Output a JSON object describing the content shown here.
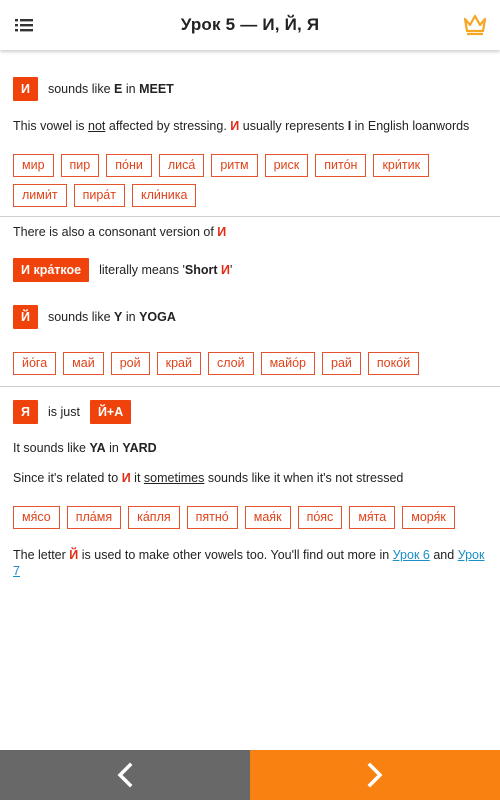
{
  "appbar": {
    "title": "Урок 5 — И, Й, Я",
    "menu_icon": "hamburger-menu-icon",
    "premium_icon": "crown-icon",
    "accent_color": "#f5a623"
  },
  "colors": {
    "badge": "#f0420b",
    "chip_border": "#e5542e",
    "highlight_letter": "#e32b15",
    "link": "#1b8fc7",
    "prev_button": "#686868",
    "next_button": "#f88112"
  },
  "section_i": {
    "badge": "И",
    "sounds": "sounds like",
    "sound_letter": "E",
    "in": "in",
    "example_word": "MEET",
    "para_part1": "This vowel is",
    "para_not": "not",
    "para_part2": "affected by stressing.",
    "para_letter": "И",
    "para_part3": "usually represents",
    "para_i": "I",
    "para_part4": "in English loanwords",
    "chips": [
      "мир",
      "пир",
      "по́ни",
      "лиса́",
      "ритм",
      "риск",
      "пито́н",
      "кри́тик",
      "лими́т",
      "пира́т",
      "кли́ника"
    ]
  },
  "section_y": {
    "consonant_text": "There is also a consonant version of",
    "consonant_letter": "И",
    "short_badge": "И кра́ткое",
    "literally": "literally means",
    "quote_open": "'",
    "short_word": "Short",
    "short_letter": "И",
    "quote_close": "'",
    "badge": "Й",
    "sounds": "sounds like",
    "sound_letter": "Y",
    "in": "in",
    "example_word": "YOGA",
    "chips": [
      "йо́га",
      "май",
      "рой",
      "край",
      "слой",
      "майо́р",
      "рай",
      "поко́й"
    ]
  },
  "section_ya": {
    "badge": "Я",
    "is_just": "is just",
    "combo_badge": "Й+А",
    "sounds_part1": "It sounds like",
    "sound_letters": "YA",
    "in": "in",
    "example_word": "YARD",
    "related_part1": "Since it's related to",
    "related_letter": "И",
    "related_part2": "it",
    "related_sometimes": "sometimes",
    "related_part3": "sounds like it when it's not stressed",
    "chips": [
      "мя́со",
      "пла́мя",
      "ка́пля",
      "пятно́",
      "мая́к",
      "по́яс",
      "мя́та",
      "моря́к"
    ]
  },
  "footer_note": {
    "part1": "The letter",
    "letter": "Й",
    "part2": "is used to make other vowels too. You'll find out more in",
    "link1": "Урок 6",
    "and": "and",
    "link2": "Урок 7"
  },
  "nav": {
    "prev_icon": "chevron-left-icon",
    "next_icon": "chevron-right-icon"
  }
}
